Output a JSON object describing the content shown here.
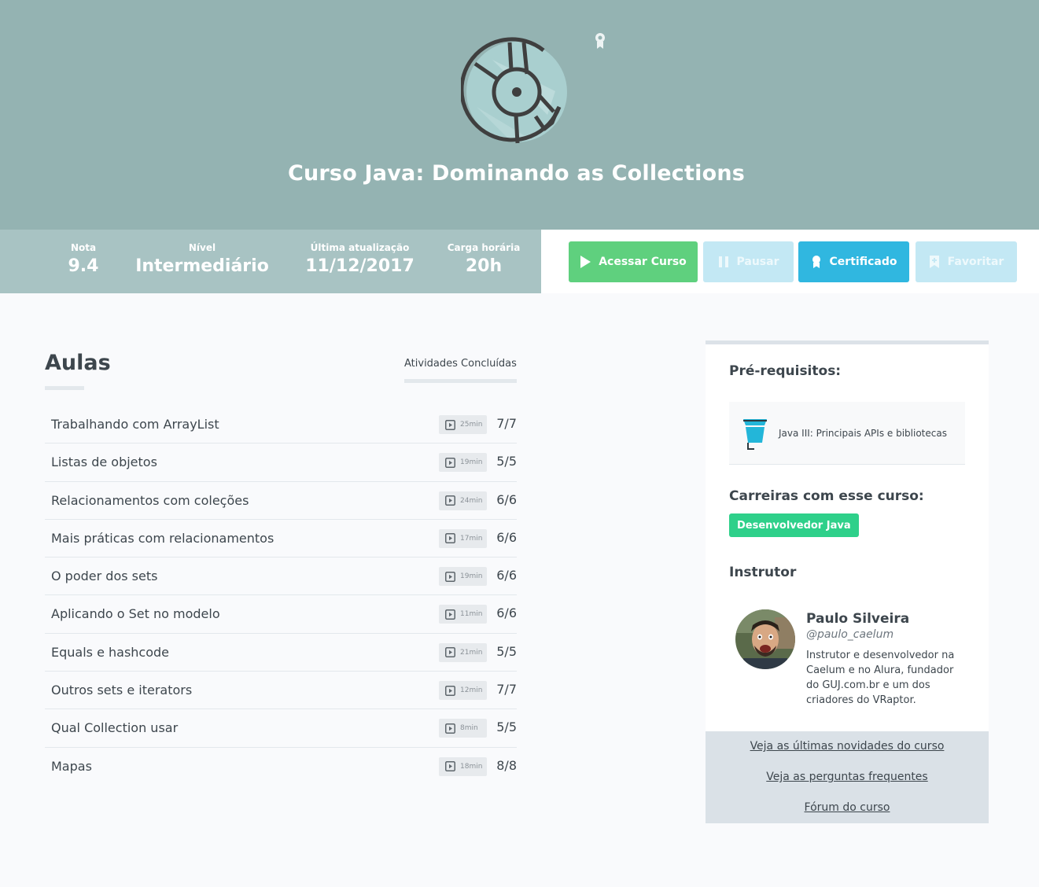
{
  "hero": {
    "title": "Curso Java: Dominando as Collections",
    "logo_icon": "collections-disc-icon",
    "badge_icon": "certificate-badge-icon",
    "background": "#94b3b2"
  },
  "stats": [
    {
      "label": "Nota",
      "value": "9.4"
    },
    {
      "label": "Nível",
      "value": "Intermediário"
    },
    {
      "label": "Última atualização",
      "value": "11/12/2017"
    },
    {
      "label": "Carga horária",
      "value": "20h"
    }
  ],
  "actions": {
    "acessar": "Acessar Curso",
    "pausar": "Pausar",
    "certificado": "Certificado",
    "favoritar": "Favoritar",
    "colors": {
      "acessar": "#5fd07e",
      "certificado": "#30b7e0",
      "disabled": "#c3e8f4"
    }
  },
  "aulas": {
    "title": "Aulas",
    "concluidas_label": "Atividades Concluídas",
    "lessons": [
      {
        "title": "Trabalhando com ArrayList",
        "duration": "25min",
        "progress": "7/7"
      },
      {
        "title": "Listas de objetos",
        "duration": "19min",
        "progress": "5/5"
      },
      {
        "title": "Relacionamentos com coleções",
        "duration": "24min",
        "progress": "6/6"
      },
      {
        "title": "Mais práticas com relacionamentos",
        "duration": "17min",
        "progress": "6/6"
      },
      {
        "title": "O poder dos sets",
        "duration": "19min",
        "progress": "6/6"
      },
      {
        "title": "Aplicando o Set no modelo",
        "duration": "11min",
        "progress": "6/6"
      },
      {
        "title": "Equals e hashcode",
        "duration": "21min",
        "progress": "5/5"
      },
      {
        "title": "Outros sets e iterators",
        "duration": "12min",
        "progress": "7/7"
      },
      {
        "title": "Qual Collection usar",
        "duration": "8min",
        "progress": "5/5"
      },
      {
        "title": "Mapas",
        "duration": "18min",
        "progress": "8/8"
      }
    ]
  },
  "sidebar": {
    "prereq_heading": "Pré-requisitos:",
    "prereq_course": "Java III: Principais APIs e bibliotecas",
    "careers_heading": "Carreiras com esse curso:",
    "career": "Desenvolvedor Java",
    "instructor_heading": "Instrutor",
    "instructor": {
      "name": "Paulo Silveira",
      "handle": "@paulo_caelum",
      "bio": "Instrutor e desenvolvedor na Caelum e no Alura, fundador do GUJ.com.br e um dos criadores do VRaptor."
    },
    "links": [
      "Veja as últimas novidades do curso",
      "Veja as perguntas frequentes",
      "Fórum do curso"
    ]
  }
}
